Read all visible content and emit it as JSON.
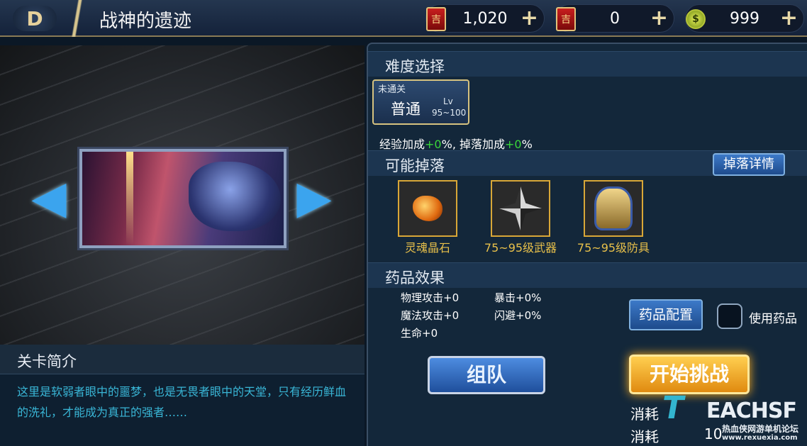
{
  "header": {
    "back_icon": "back-arrow-icon",
    "title": "战神的遗迹",
    "currencies": [
      {
        "icon": "locked-red-book-icon",
        "value": "1,020",
        "plus": "+"
      },
      {
        "icon": "red-book-icon",
        "value": "0",
        "plus": "+"
      },
      {
        "icon": "gold-coin-icon",
        "value": "999",
        "plus": "+"
      }
    ]
  },
  "stage": {
    "prev_arrow": "◀",
    "next_arrow": "▶",
    "intro_title": "关卡简介",
    "intro_text": "这里是软弱者眼中的噩梦，也是无畏者眼中的天堂，只有经历鲜血的洗礼，才能成为真正的强者……"
  },
  "difficulty": {
    "section_title": "难度选择",
    "card": {
      "tag": "未通关",
      "name": "普通",
      "lv_label": "Lv",
      "lv_range": "95~100"
    },
    "bonus_exp_label": "经验加成",
    "bonus_exp_value": "+0",
    "bonus_pct1": "%, ",
    "bonus_drop_label": "掉落加成",
    "bonus_drop_value": "+0",
    "bonus_pct2": "%"
  },
  "drops": {
    "section_title": "可能掉落",
    "detail_button": "掉落详情",
    "items": [
      {
        "icon": "soul-crystal-icon",
        "label": "灵魂晶石"
      },
      {
        "icon": "weapon-icon",
        "label": "75~95级武器"
      },
      {
        "icon": "armor-icon",
        "label": "75~95级防具"
      }
    ]
  },
  "potions": {
    "section_title": "药品效果",
    "stats_left": [
      "物理攻击+0",
      "魔法攻击+0",
      "生命+0"
    ],
    "stats_right": [
      "暴击+0%",
      "闪避+0%"
    ],
    "config_button": "药品配置",
    "use_label": "使用药品",
    "use_checked": false
  },
  "actions": {
    "team_button": "组队",
    "start_button": "开始挑战",
    "cost1_label": "消耗",
    "cost2_label": "消耗",
    "cost2_value": "10"
  },
  "watermark": {
    "logo": "T",
    "brand": "EACHSF",
    "sub1": "热血侠网游单机论坛",
    "sub2": "www.rexuexia.com"
  },
  "colors": {
    "gold_accent": "#d6c27f",
    "bonus_green": "#39d639",
    "intro_text": "#39b6d6",
    "drop_label": "#e8c04a",
    "start_button": "#f0a020",
    "team_button": "#2f6fc8"
  }
}
